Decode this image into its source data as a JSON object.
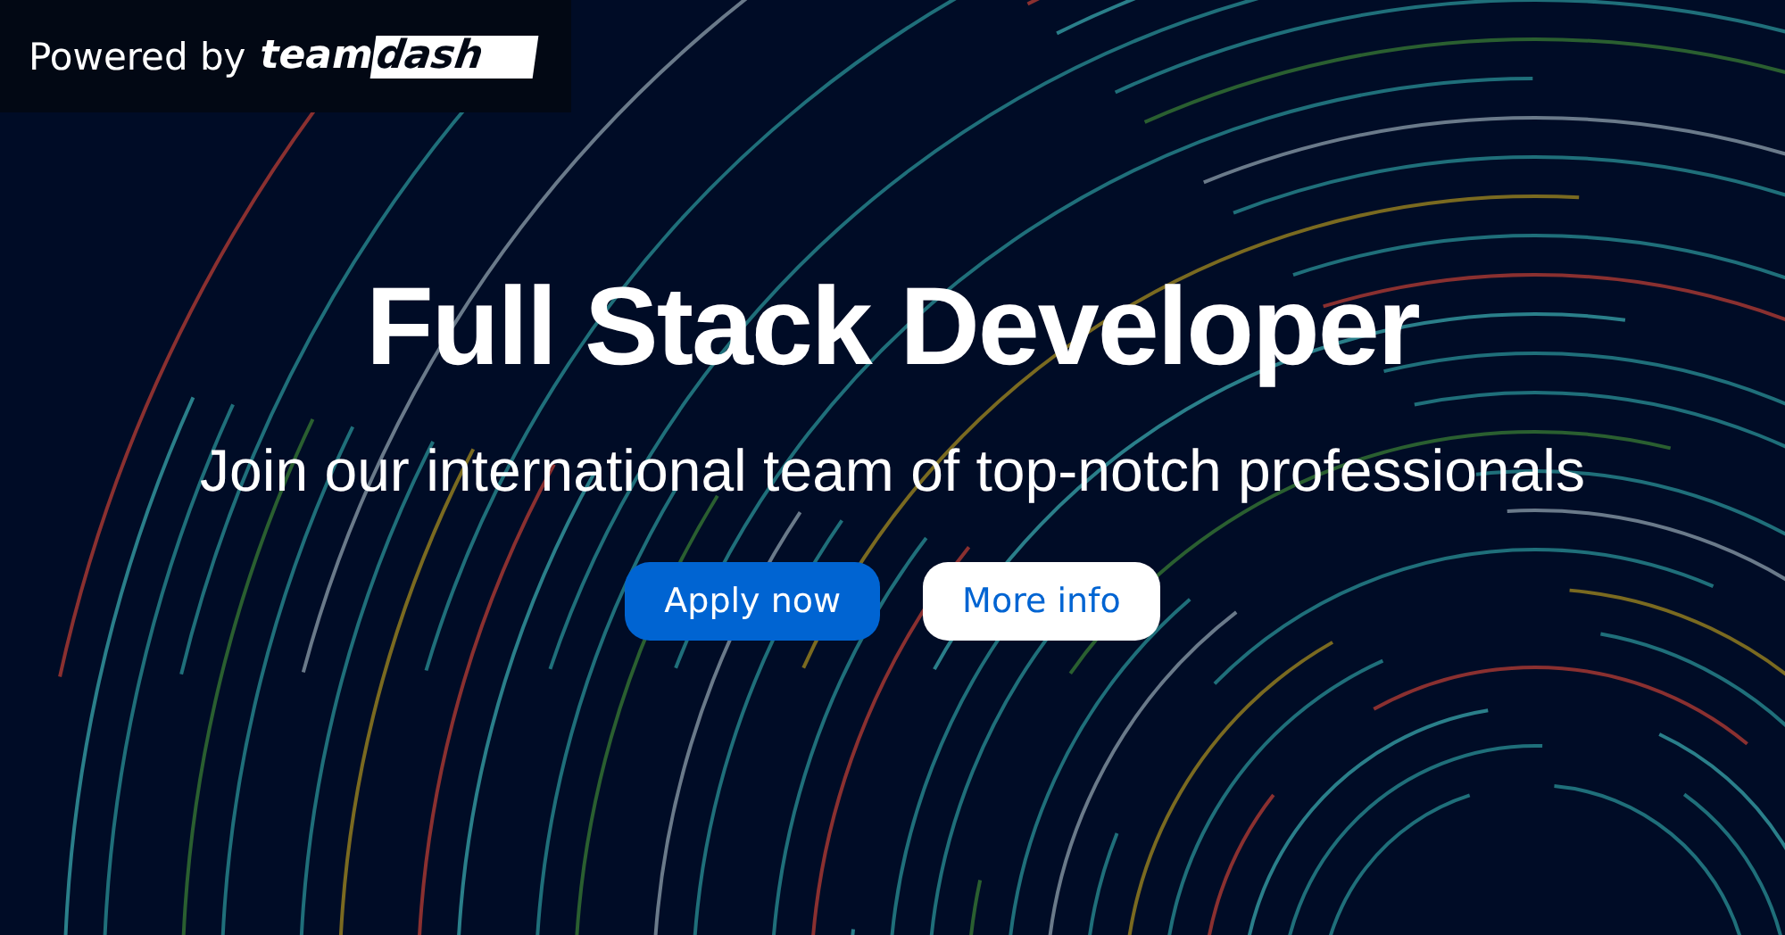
{
  "badge": {
    "prefix": "Powered by",
    "logo_text": "team",
    "logo_highlight": "dash"
  },
  "title": "Full Stack Developer",
  "subtitle": "Join our international team of top-notch professionals",
  "buttons": [
    {
      "label": "Apply now",
      "kind": "primary"
    },
    {
      "label": "More info",
      "kind": "secondary"
    }
  ]
}
